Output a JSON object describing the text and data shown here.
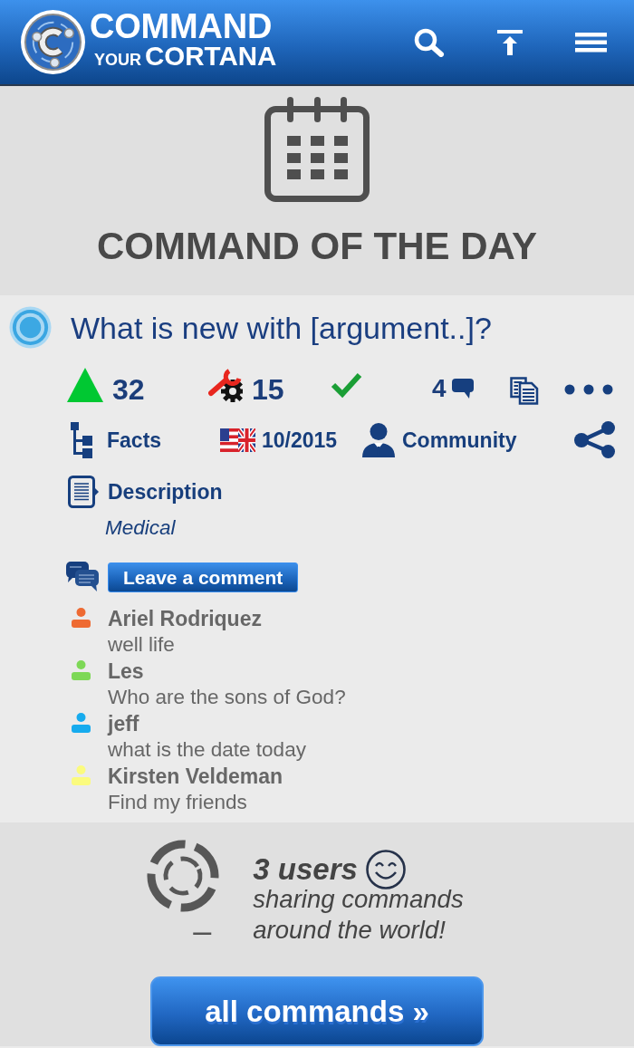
{
  "header": {
    "logo_line_1": "COMMAND",
    "logo_line_2_prefix": "YOUR",
    "logo_line_2": "CORTANA"
  },
  "hero": {
    "title": "COMMAND OF THE DAY"
  },
  "command": {
    "title": "What is new with [argument..]?",
    "votes": "32",
    "tools": "15",
    "verified": true,
    "comments_count": "4",
    "category": "Facts",
    "date": "10/2015",
    "author": "Community",
    "description_label": "Description",
    "description": "Medical"
  },
  "comments": {
    "button": "Leave a comment",
    "items": [
      {
        "name": "Ariel Rodriquez",
        "text": "well life",
        "color": "#ee6a32"
      },
      {
        "name": "Les",
        "text": "Who are the sons of God?",
        "color": "#7dd856"
      },
      {
        "name": "jeff",
        "text": "what is the date today",
        "color": "#16abee"
      },
      {
        "name": "Kirsten Veldeman",
        "text": "Find my friends",
        "color": "#fbfb7e"
      }
    ]
  },
  "community": {
    "dash": "–",
    "users": "3 users",
    "line_1": "sharing commands",
    "line_2": "around the world!"
  },
  "all_commands_button": "all commands »"
}
